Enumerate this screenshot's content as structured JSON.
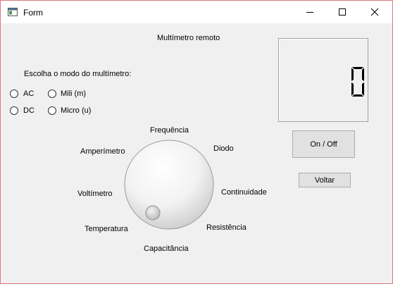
{
  "window": {
    "title": "Form"
  },
  "header": {
    "title": "Multímetro remoto"
  },
  "mode": {
    "prompt": "Escolha o modo do multímetro:",
    "options": [
      {
        "label": "AC",
        "selected": false
      },
      {
        "label": "Mili (m)",
        "selected": false
      },
      {
        "label": "DC",
        "selected": false
      },
      {
        "label": "Micro (u)",
        "selected": false
      }
    ]
  },
  "display": {
    "value": "0"
  },
  "buttons": {
    "on_off": "On / Off",
    "back": "Voltar"
  },
  "dial": {
    "labels": {
      "frequency": "Frequência",
      "diode": "Diodo",
      "continuity": "Continuidade",
      "resistance": "Resistência",
      "capacitance": "Capacitância",
      "temperature": "Temperatura",
      "voltmeter": "Voltímetro",
      "ammeter": "Amperímetro"
    }
  },
  "colors": {
    "titlebar": "#ffffff",
    "window_border": "#d9787b",
    "background": "#f0f0f0",
    "segment": "#000000"
  }
}
